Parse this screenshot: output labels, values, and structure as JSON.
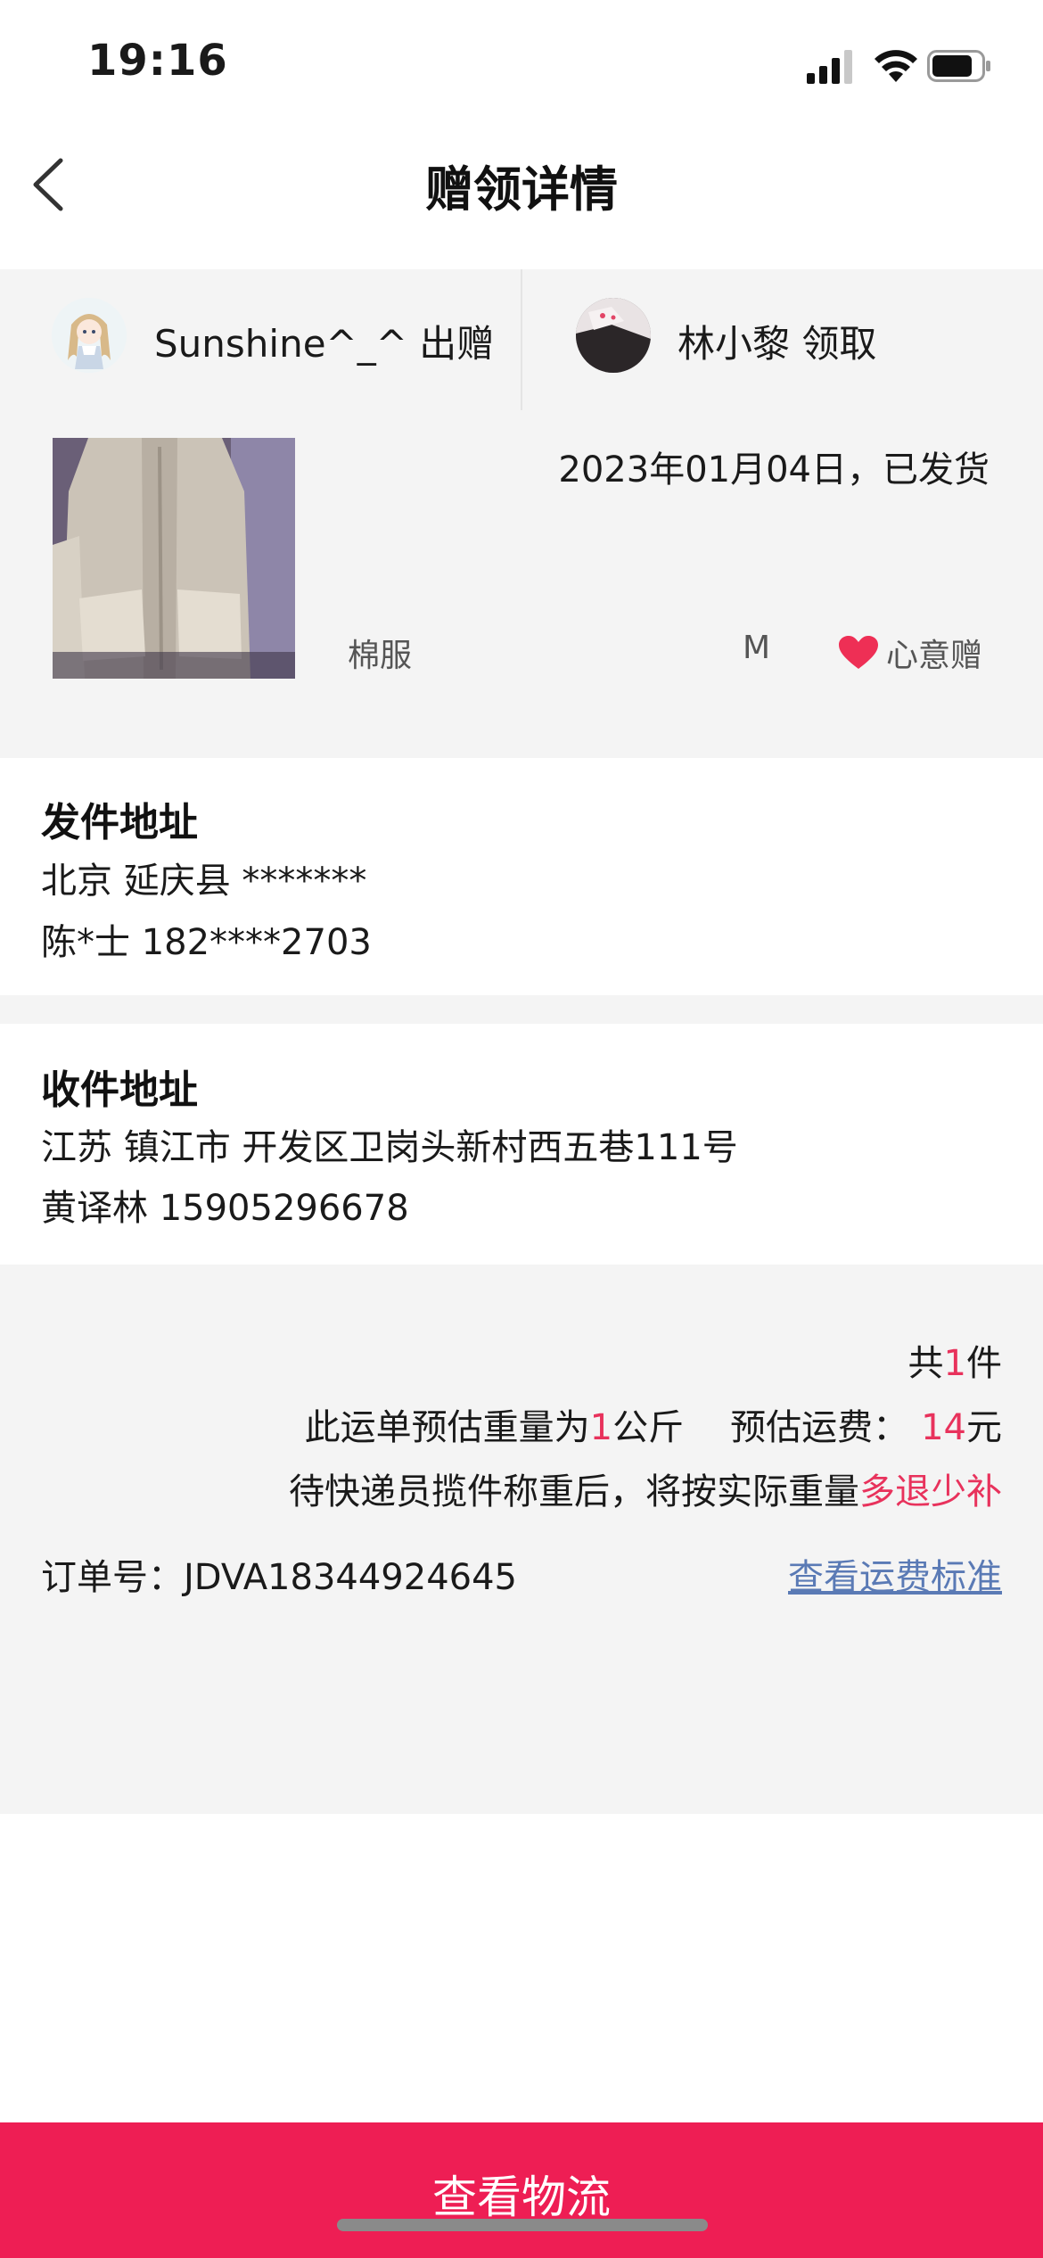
{
  "status_bar": {
    "time": "19:16"
  },
  "nav": {
    "title": "赠领详情",
    "back_icon": "chevron-left-icon"
  },
  "users": {
    "giver": {
      "name_action": "Sunshine^_^ 出赠"
    },
    "receiver": {
      "name_action": "林小黎 领取"
    }
  },
  "item": {
    "date_status": "2023年01月04日，已发货",
    "name": "棉服",
    "size": "M",
    "tag": "心意赠",
    "tag_icon": "heart-icon"
  },
  "send_address": {
    "heading": "发件地址",
    "line1": "北京 延庆县 *******",
    "line2": "陈*士 182****2703"
  },
  "receive_address": {
    "heading": "收件地址",
    "line1": "江苏 镇江市 开发区卫岗头新村西五巷111号",
    "line2": "黄译林 15905296678"
  },
  "fee": {
    "count_prefix": "共",
    "count": "1",
    "count_suffix": "件",
    "weight_prefix": "此运单预估重量为",
    "weight_value": "1",
    "weight_unit": "公斤",
    "freight_label": "预估运费：",
    "freight_value": "14",
    "freight_unit": "元",
    "note_prefix": "待快递员揽件称重后，将按实际重量",
    "note_highlight": "多退少补",
    "order_label": "订单号：JDVA18344924645",
    "standard_link": "查看运费标准"
  },
  "bottom_button": {
    "label": "查看物流"
  },
  "colors": {
    "accent": "#ee1e54",
    "highlight": "#e8325c",
    "link": "#5a7ab5",
    "section_bg": "#f4f4f4"
  }
}
